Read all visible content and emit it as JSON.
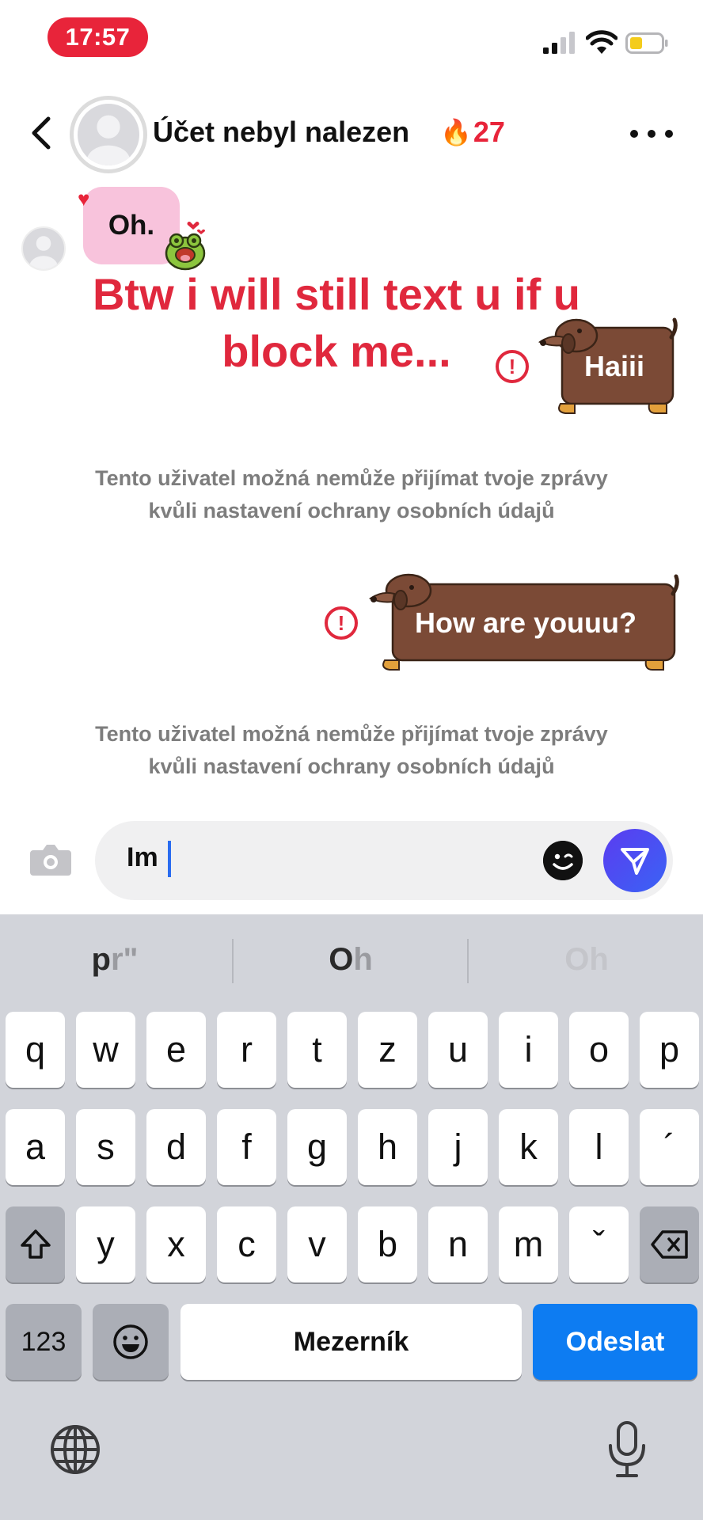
{
  "status_bar": {
    "time": "17:57"
  },
  "header": {
    "title": "Účet nebyl nalezen",
    "streak_emoji": "🔥",
    "streak_count": "27"
  },
  "messages": {
    "incoming_text": "Oh.",
    "overlay_text": "Btw i will still text u if u block me...",
    "outgoing_1": "Haiii",
    "outgoing_2": "How are youuu?",
    "delivery_notice": "Tento uživatel možná nemůže přijímat tvoje zprávy kvůli nastavení ochrany osobních údajů",
    "warning_symbol": "!"
  },
  "composer": {
    "text": "Im"
  },
  "keyboard": {
    "suggestions": [
      {
        "main": "p",
        "dim": "r\""
      },
      {
        "main": "O",
        "dim": "h"
      },
      {
        "main": "",
        "dim": "Oh"
      }
    ],
    "row1": [
      "q",
      "w",
      "e",
      "r",
      "t",
      "z",
      "u",
      "i",
      "o",
      "p"
    ],
    "row2": [
      "a",
      "s",
      "d",
      "f",
      "g",
      "h",
      "j",
      "k",
      "l",
      "´"
    ],
    "row3": [
      "y",
      "x",
      "c",
      "v",
      "b",
      "n",
      "m",
      "ˇ"
    ],
    "numbers_label": "123",
    "space_label": "Mezerník",
    "send_label": "Odeslat"
  },
  "colors": {
    "accent_red": "#e0283d",
    "bubble_pink": "#f8c3dc",
    "sticker_brown": "#7b4a36",
    "send_blue": "#0d7cf2"
  },
  "icons": {
    "back": "chevron-left-icon",
    "more": "more-horizontal-icon",
    "camera": "camera-icon",
    "emoji": "emoji-sticker-icon",
    "send": "send-icon",
    "shift": "shift-icon",
    "delete": "backspace-icon",
    "globe": "globe-icon",
    "mic": "microphone-icon"
  }
}
